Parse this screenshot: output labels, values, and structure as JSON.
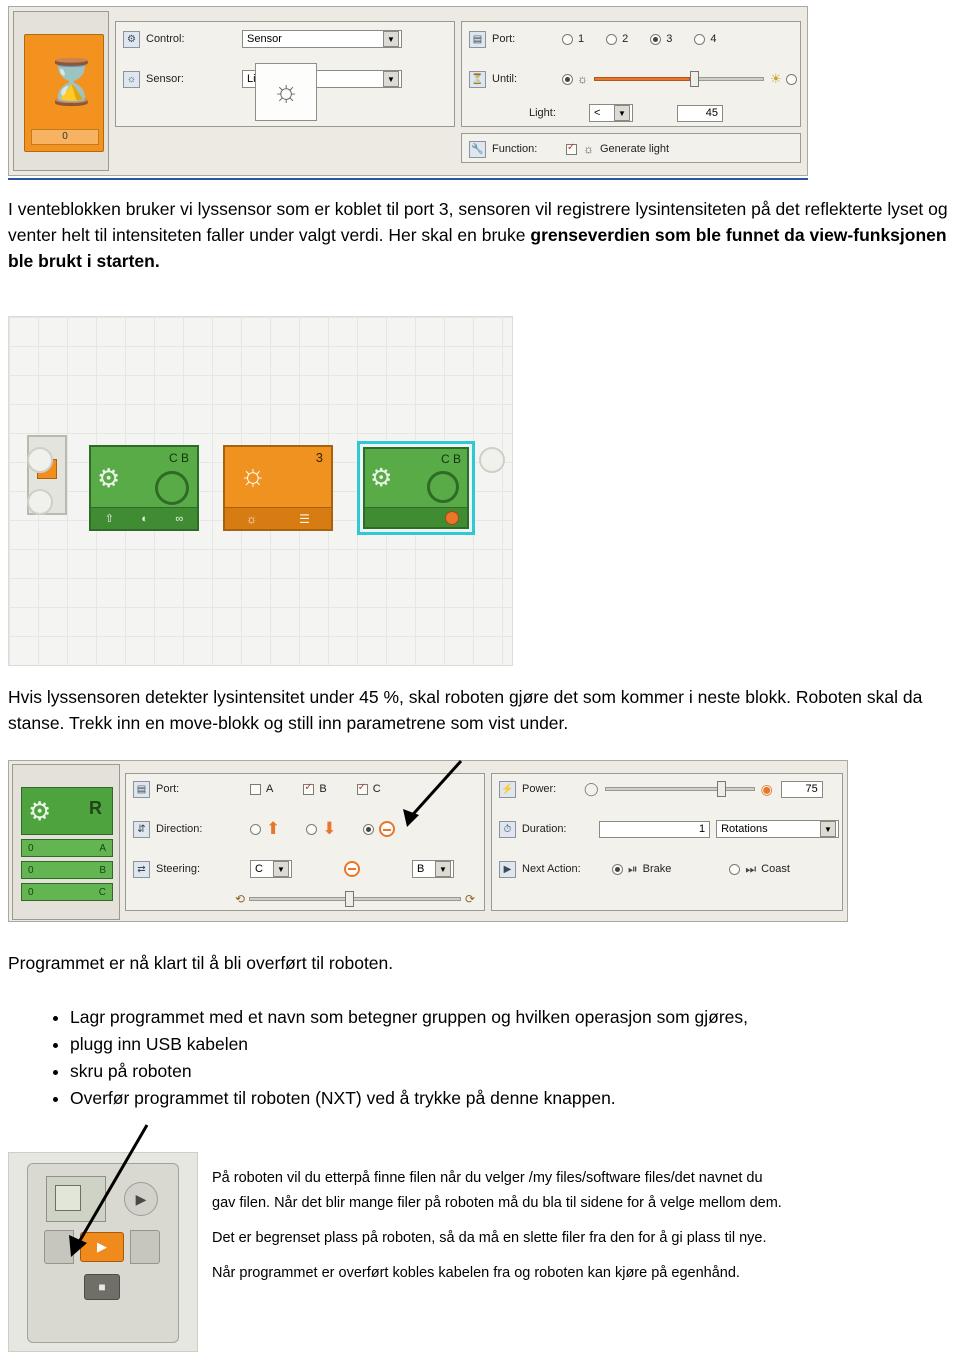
{
  "wait_block": {
    "title": "Wait",
    "value_display": "0",
    "rows": {
      "control": {
        "label": "Control:",
        "value": "Sensor"
      },
      "sensor": {
        "label": "Sensor:",
        "value": "Light Sensor"
      },
      "port": {
        "label": "Port:",
        "options": [
          "1",
          "2",
          "3",
          "4"
        ],
        "selected": "3"
      },
      "until": {
        "label": "Until:",
        "left_selected": true
      },
      "light": {
        "label": "Light:",
        "comparator": "<",
        "value": "45"
      },
      "function": {
        "label": "Function:",
        "checkbox_checked": true,
        "text": "Generate light"
      }
    }
  },
  "paragraph1": {
    "line1": "I venteblokken bruker vi lyssensor som er koblet til port 3, sensoren vil registrere lysintensiteten på",
    "line2": "det reflekterte lyset og venter helt til intensiteten faller under valgt verdi. Her skal en bruke",
    "line3": "grenseverdien som ble funnet da view-funksjonen ble brukt i starten."
  },
  "program_canvas": {
    "blocks": [
      {
        "name": "move-block-1",
        "labels": [
          "C B"
        ]
      },
      {
        "name": "wait-light-block",
        "labels": [
          "3"
        ]
      },
      {
        "name": "move-block-2",
        "labels": [
          "C B"
        ],
        "selected": true
      }
    ]
  },
  "paragraph2": {
    "line1": "Hvis lyssensoren detekter lysintensitet under 45 %, skal roboten gjøre det som kommer i neste",
    "line2": "blokk. Roboten skal da stanse. Trekk inn en move-blokk og still inn parametrene som vist under."
  },
  "move_block": {
    "title": "Move",
    "motor_letter": "R",
    "motor_rows": [
      {
        "value": "0",
        "port": "A"
      },
      {
        "value": "0",
        "port": "B"
      },
      {
        "value": "0",
        "port": "C"
      }
    ],
    "rows": {
      "port": {
        "label": "Port:",
        "options": [
          {
            "label": "A",
            "checked": false
          },
          {
            "label": "B",
            "checked": true
          },
          {
            "label": "C",
            "checked": true
          }
        ]
      },
      "direction": {
        "label": "Direction:",
        "options": [
          "up",
          "down",
          "stop"
        ],
        "selected": "stop"
      },
      "steering": {
        "label": "Steering:",
        "left": "C",
        "right": "B"
      },
      "power": {
        "label": "Power:",
        "value": "75"
      },
      "duration": {
        "label": "Duration:",
        "value": "1",
        "unit": "Rotations"
      },
      "next_action": {
        "label": "Next Action:",
        "options": [
          "Brake",
          "Coast"
        ],
        "selected": "Brake"
      }
    }
  },
  "paragraph3": {
    "text": "Programmet er nå klart til å bli overført til roboten."
  },
  "bullets": [
    "Lagr programmet med et navn som betegner gruppen og hvilken operasjon som gjøres,",
    "plugg inn USB kabelen",
    "skru på roboten",
    "Overfør programmet til roboten (NXT) ved å trykke på denne knappen."
  ],
  "notes": {
    "line1": "På roboten vil du etterpå finne filen når du velger /my files/software files/det navnet du",
    "line2": "gav filen. Når det blir mange filer på roboten må du bla til sidene for å velge mellom dem.",
    "line3": "Det er begrenset plass på roboten, så da må en slette filer fra den for å gi plass til nye.",
    "line4": "Når programmet er overført kobles kabelen fra og roboten kan kjøre på egenhånd."
  },
  "colors": {
    "wait_orange": "#f4921f",
    "move_green": "#4fa33f",
    "selected_cyan": "#33c7d6",
    "panel_bg": "#e9e9e4"
  }
}
